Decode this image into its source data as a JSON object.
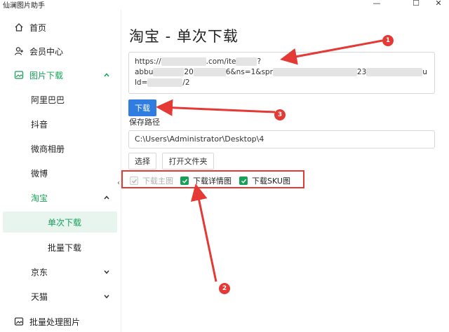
{
  "window": {
    "title": "仙澜图片助手",
    "minimize_glyph": "—",
    "maximize_glyph": "☐",
    "close_glyph": "✕"
  },
  "sidebar": {
    "items": [
      {
        "label": "首页",
        "icon": "home-icon"
      },
      {
        "label": "会员中心",
        "icon": "user-icon"
      },
      {
        "label": "图片下载",
        "icon": "image-icon",
        "expanded": true
      },
      {
        "label": "阿里巴巴"
      },
      {
        "label": "抖音"
      },
      {
        "label": "微商相册"
      },
      {
        "label": "微博"
      },
      {
        "label": "淘宝",
        "expanded": true
      },
      {
        "label": "单次下载",
        "active": true
      },
      {
        "label": "批量下载"
      },
      {
        "label": "京东",
        "expanded": false
      },
      {
        "label": "天猫",
        "expanded": false
      },
      {
        "label": "批量处理图片",
        "icon": "batch-image-icon"
      }
    ]
  },
  "main": {
    "page_title": "淘宝 - 单次下载",
    "url_lines": [
      "https://",
      ".com/ite",
      "?",
      "abbu",
      "20",
      "6&ns=1&spr",
      "23",
      "u",
      "ld=",
      "/2"
    ],
    "download_label": "下载",
    "save_path_label": "保存路径",
    "save_path_value": "C:\\Users\\Administrator\\Desktop\\4",
    "select_label": "选择",
    "open_folder_label": "打开文件夹",
    "checkboxes": [
      {
        "label": "下载主图",
        "checked": true,
        "disabled": true
      },
      {
        "label": "下载详情图",
        "checked": true,
        "disabled": false
      },
      {
        "label": "下载SKU图",
        "checked": true,
        "disabled": false
      }
    ]
  },
  "annotations": {
    "badge_1": "1",
    "badge_2": "2",
    "badge_3": "3",
    "color": "#e53935"
  },
  "colors": {
    "accent_green": "#18a058",
    "button_blue": "#2f7de1",
    "annotation_red": "#e53935"
  }
}
